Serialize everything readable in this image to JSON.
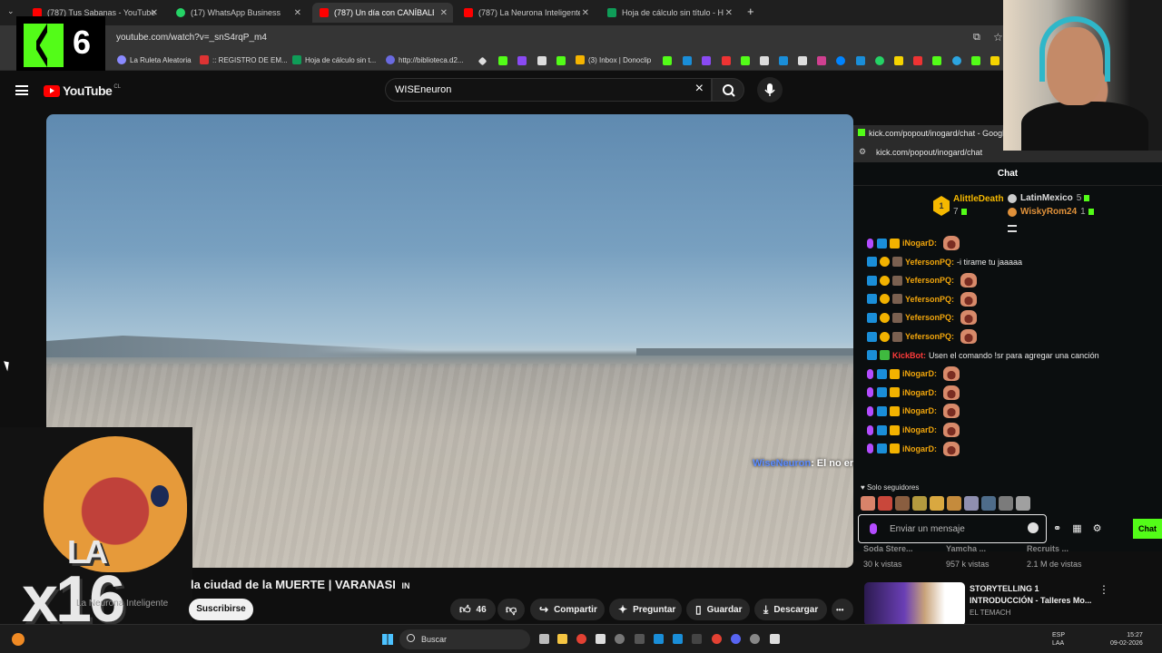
{
  "browser": {
    "tabs": [
      {
        "title": "(787) Tus Sabanas - YouTube",
        "color": "#ff0000",
        "active": false
      },
      {
        "title": "(17) WhatsApp Business",
        "color": "#25d366",
        "active": false
      },
      {
        "title": "(787) Un día con CANÍBALES en",
        "color": "#ff0000",
        "active": true
      },
      {
        "title": "(787) La Neurona Inteligente - ",
        "color": "#ff0000",
        "active": false
      },
      {
        "title": "Hoja de cálculo sin título - Hoja",
        "color": "#0f9d58",
        "active": false
      }
    ],
    "url": "youtube.com/watch?v=_snS4rqP_m4",
    "bookmarks": [
      "La Ruleta Aleatoria",
      ":: REGISTRO DE EM...",
      "Hoja de cálculo sin t...",
      "http://biblioteca.d2...",
      "(3) Inbox | Donoclip"
    ]
  },
  "overlay": {
    "kick_number": "6",
    "sticker_la": "LA",
    "sticker_x": "x16"
  },
  "youtube": {
    "logo": "YouTube",
    "country": "CL",
    "search_value": "WISEneuron",
    "video_title": "la ciudad de la MUERTE | VARANASI",
    "video_title_tag": "IN",
    "channel": "La Neurona Inteligente",
    "subscribe_label": "Suscribirse",
    "likes": "46",
    "share_label": "Compartir",
    "ask_label": "Preguntar",
    "save_label": "Guardar",
    "download_label": "Descargar",
    "more_label": "•••"
  },
  "chat": {
    "window_title": "kick.com/popout/inogard/chat - Google C",
    "url": "kick.com/popout/inogard/chat",
    "header": "Chat",
    "leaders": {
      "top": {
        "name": "AlittleDeath",
        "count": "7"
      },
      "second": {
        "name": "LatinMexico",
        "count": "5"
      },
      "third": {
        "name": "WiskyRom24",
        "count": "1"
      }
    },
    "messages": [
      {
        "user": "iNogarD:",
        "text": "",
        "color": "#f2a60c",
        "emote": true
      },
      {
        "user": "YefersonPQ:",
        "text": "-i tirame tu jaaaaa",
        "color": "#f2a60c",
        "emote": false
      },
      {
        "user": "YefersonPQ:",
        "text": "",
        "color": "#f2a60c",
        "emote": true
      },
      {
        "user": "YefersonPQ:",
        "text": "",
        "color": "#f2a60c",
        "emote": true
      },
      {
        "user": "YefersonPQ:",
        "text": "",
        "color": "#f2a60c",
        "emote": true
      },
      {
        "user": "YefersonPQ:",
        "text": "",
        "color": "#f2a60c",
        "emote": true
      },
      {
        "user": "KickBot:",
        "text": "Usen el comando !sr para agregar una canción",
        "color": "#ff3b3b",
        "emote": false
      },
      {
        "user": "iNogarD:",
        "text": "",
        "color": "#f2a60c",
        "emote": true
      },
      {
        "user": "iNogarD:",
        "text": "",
        "color": "#f2a60c",
        "emote": true
      },
      {
        "user": "iNogarD:",
        "text": "",
        "color": "#f2a60c",
        "emote": true
      },
      {
        "user": "iNogarD:",
        "text": "",
        "color": "#f2a60c",
        "emote": true
      },
      {
        "user": "iNogarD:",
        "text": "",
        "color": "#f2a60c",
        "emote": true
      }
    ],
    "overlay_message": {
      "user": "WiseNeuron",
      "text": ": El no era un aghori :)"
    },
    "followers_only": "♥ Solo seguidores",
    "input_placeholder": "Enviar un mensaje",
    "send_label": "Chat"
  },
  "recommendations": [
    {
      "title": "Soda Stere...",
      "views": "30 k vistas"
    },
    {
      "title": "Yamcha ...",
      "views": "957 k vistas"
    },
    {
      "title": "Recruits ...",
      "views": "2.1 M de vistas"
    }
  ],
  "rec_featured": {
    "title_line1": "STORYTELLING 1",
    "title_line2": "INTRODUCCIÓN - Talleres Mo...",
    "channel": "EL TEMACH"
  },
  "taskbar": {
    "search_label": "Buscar",
    "lang1": "ESP",
    "lang2": "LAA",
    "time": "15:27",
    "date": "09-02-2026"
  }
}
